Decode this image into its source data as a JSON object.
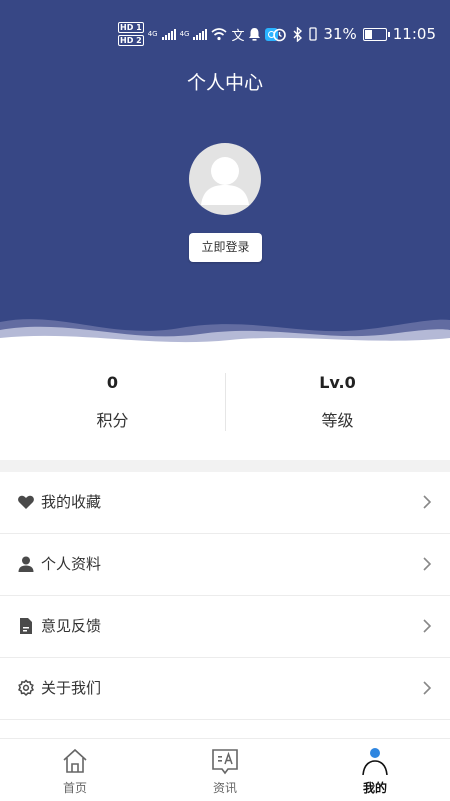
{
  "status_bar": {
    "hd1": "HD 1",
    "hd2": "HD 2",
    "net1": "4G",
    "net2": "4G",
    "ime": "文",
    "battery": "31%",
    "time": "11:05"
  },
  "header": {
    "title": "个人中心",
    "login_label": "立即登录",
    "background_color": "#374785"
  },
  "stats": {
    "points_value": "0",
    "points_label": "积分",
    "level_value": "Lv.0",
    "level_label": "等级"
  },
  "menu": {
    "items": [
      {
        "label": "我的收藏",
        "icon": "heart-icon"
      },
      {
        "label": "个人资料",
        "icon": "person-icon"
      },
      {
        "label": "意见反馈",
        "icon": "document-icon"
      },
      {
        "label": "关于我们",
        "icon": "settings-gear-icon"
      }
    ]
  },
  "tabbar": {
    "tabs": [
      {
        "label": "首页",
        "icon": "home-icon",
        "active": false
      },
      {
        "label": "资讯",
        "icon": "news-icon",
        "active": false
      },
      {
        "label": "我的",
        "icon": "profile-icon",
        "active": true
      }
    ],
    "active_color": "#2f86e0"
  }
}
